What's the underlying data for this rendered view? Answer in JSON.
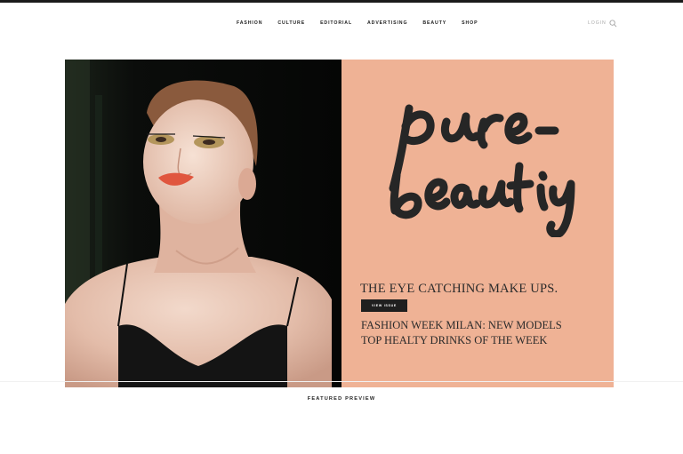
{
  "nav": {
    "items": [
      "FASHION",
      "CULTURE",
      "EDITORIAL",
      "ADVERTISING",
      "BEAUTY",
      "SHOP"
    ],
    "login_label": "LOGIN",
    "search_icon": "search-icon"
  },
  "hero": {
    "logo_text": "pure - beauty",
    "headline_main": "THE EYE CATCHING MAKE UPS.",
    "view_issue_label": "VIEW ISSUE",
    "headline_secondary_1": "FASHION WEEK MILAN: NEW MODELS",
    "headline_secondary_2": "TOP HEALTY DRINKS OF  THE WEEK",
    "panel_color": "#efb295"
  },
  "featured": {
    "title": "FEATURED PREVIEW"
  }
}
